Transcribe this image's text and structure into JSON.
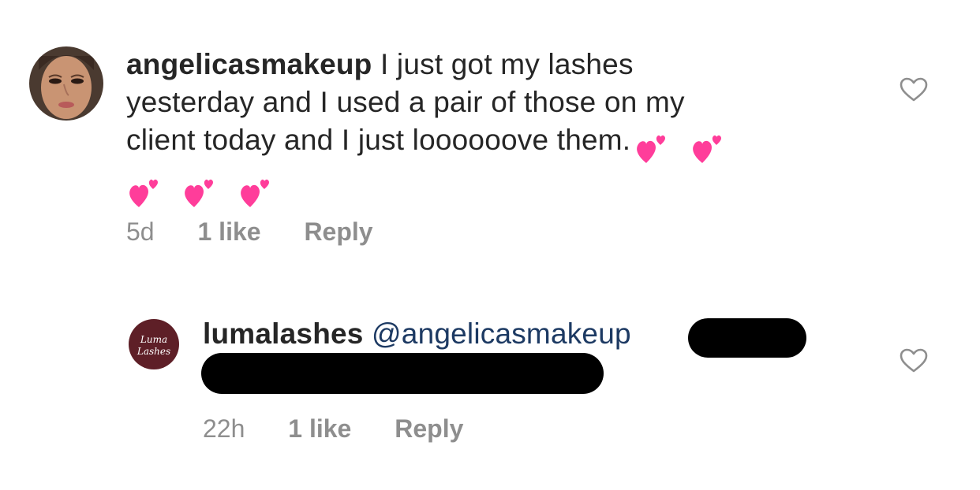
{
  "comments": [
    {
      "username": "angelicasmakeup",
      "avatar_icon": "woman-portrait-avatar",
      "text_line1": " I just got my lashes",
      "text_line2": "yesterday and I used a pair of those on my",
      "text_line3": "client today and I just loooooove them.",
      "emoji_icon": "two-hearts-emoji",
      "emoji_color": "#ff3d9a",
      "time": "5d",
      "likes": "1 like",
      "reply": "Reply"
    },
    {
      "username": "lumalashes",
      "avatar_icon": "luma-lashes-logo-avatar",
      "avatar_logo_text": "Luma Lashes",
      "mention": " @angelicasmakeup",
      "redacted": true,
      "time": "22h",
      "likes": "1 like",
      "reply": "Reply"
    }
  ],
  "colors": {
    "username": "#262626",
    "mention": "#1d3a63",
    "meta": "#8e8e8e",
    "heart_outline": "#8e8e8e",
    "logo_bg": "#5e1f27"
  }
}
